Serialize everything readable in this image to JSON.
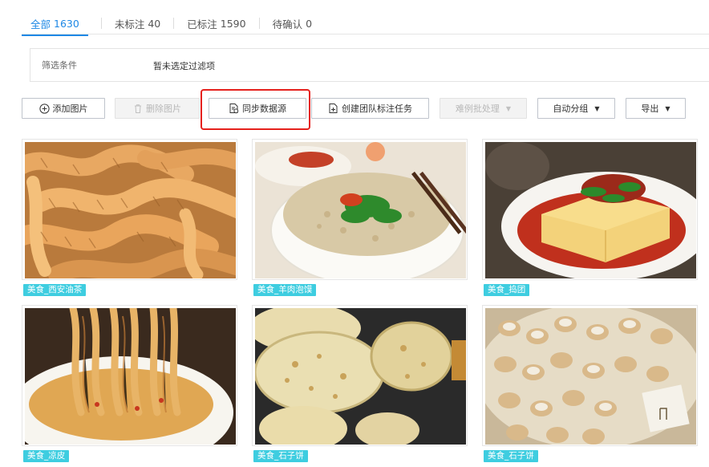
{
  "tabs": [
    {
      "label": "全部",
      "count": "1630",
      "active": true
    },
    {
      "label": "未标注",
      "count": "40"
    },
    {
      "label": "已标注",
      "count": "1590"
    },
    {
      "label": "待确认",
      "count": "0"
    }
  ],
  "filter": {
    "label": "筛选条件",
    "value": "暂未选定过滤项"
  },
  "toolbar": {
    "add_image": "添加图片",
    "delete_image": "删除图片",
    "sync_source": "同步数据源",
    "create_team_task": "创建团队标注任务",
    "hard_case": "难例批处理",
    "auto_group": "自动分组",
    "export": "导出"
  },
  "images": [
    {
      "tag": "美食_西安油茶"
    },
    {
      "tag": "美食_羊肉泡馍"
    },
    {
      "tag": "美食_捣团"
    },
    {
      "tag": "美食_凉皮"
    },
    {
      "tag": "美食_石子饼"
    },
    {
      "tag": "美食_石子饼"
    }
  ],
  "colors": {
    "accent": "#1e88e5",
    "tag_bg": "#3ecde0",
    "highlight": "#e5211d"
  }
}
